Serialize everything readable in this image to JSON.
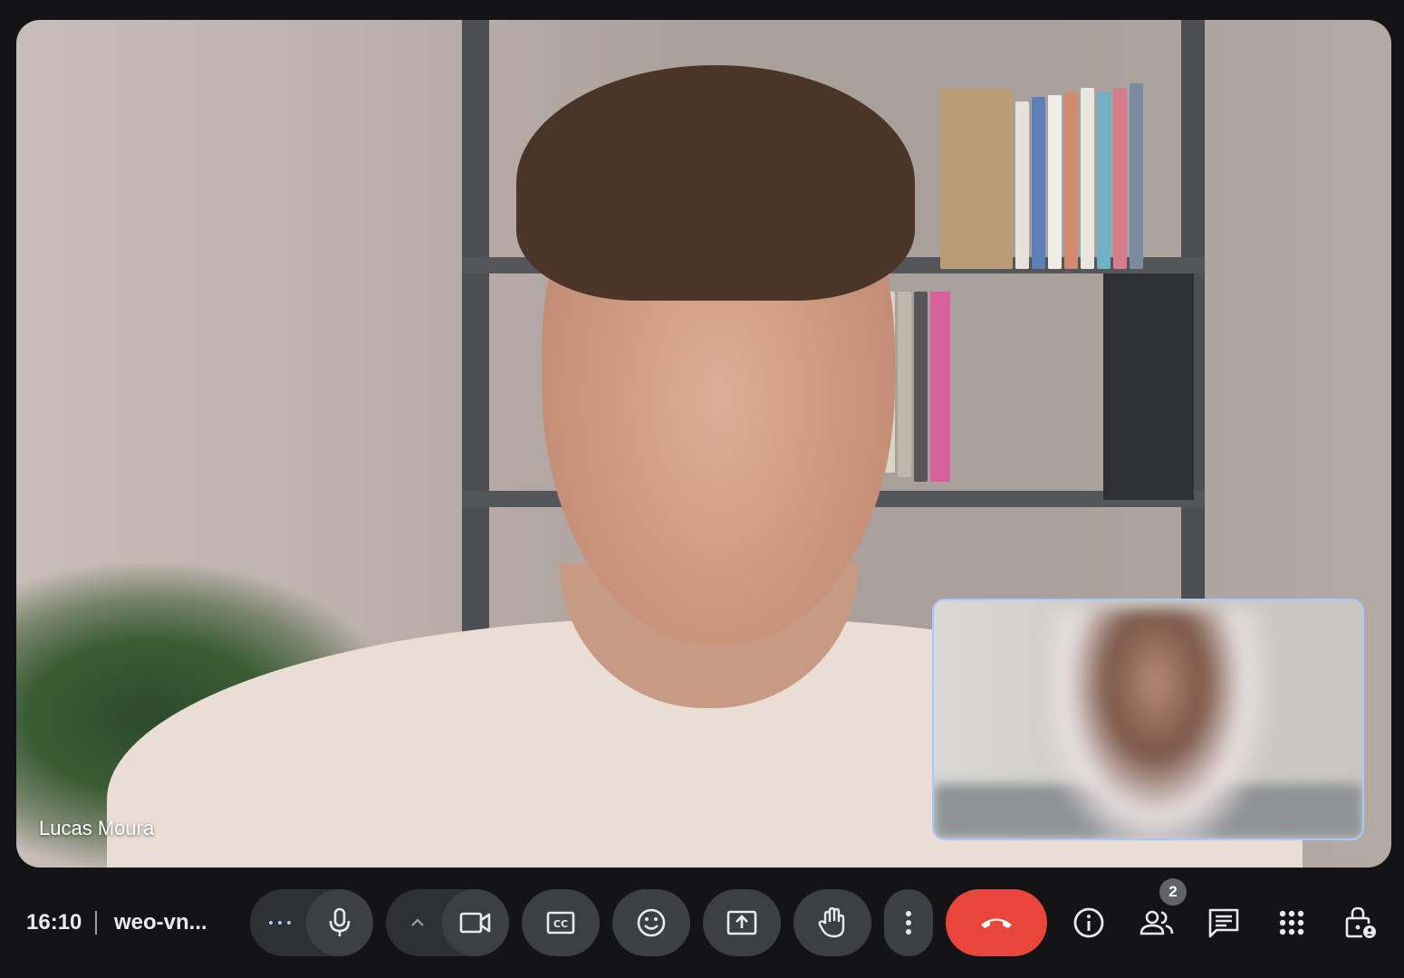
{
  "main_video": {
    "participant_name": "Lucas Moura"
  },
  "self_view": {
    "participant_name": ""
  },
  "bottom_bar": {
    "time": "16:10",
    "meeting_code": "weo-vn..."
  },
  "controls": {
    "audio_more": {
      "icon": "more-horizontal-icon"
    },
    "microphone": {
      "icon": "microphone-icon"
    },
    "video_more": {
      "icon": "chevron-up-icon"
    },
    "camera": {
      "icon": "videocam-icon"
    },
    "captions": {
      "icon": "closed-captions-icon",
      "glyph": "CC"
    },
    "reactions": {
      "icon": "emoji-icon"
    },
    "present": {
      "icon": "present-screen-icon"
    },
    "raise_hand": {
      "icon": "raise-hand-icon"
    },
    "more_options": {
      "icon": "more-vertical-icon"
    },
    "end_call": {
      "icon": "call-end-icon",
      "color": "#e9453a"
    }
  },
  "side_panel_buttons": {
    "info": {
      "icon": "info-icon"
    },
    "people": {
      "icon": "people-icon",
      "badge_count": "2"
    },
    "chat": {
      "icon": "chat-icon"
    },
    "activities": {
      "icon": "apps-grid-icon"
    },
    "host_controls": {
      "icon": "lock-person-icon"
    }
  },
  "colors": {
    "background": "#141416",
    "button": "#3c4043",
    "end_call": "#e9453a",
    "self_view_border": "#a8c7fa"
  }
}
